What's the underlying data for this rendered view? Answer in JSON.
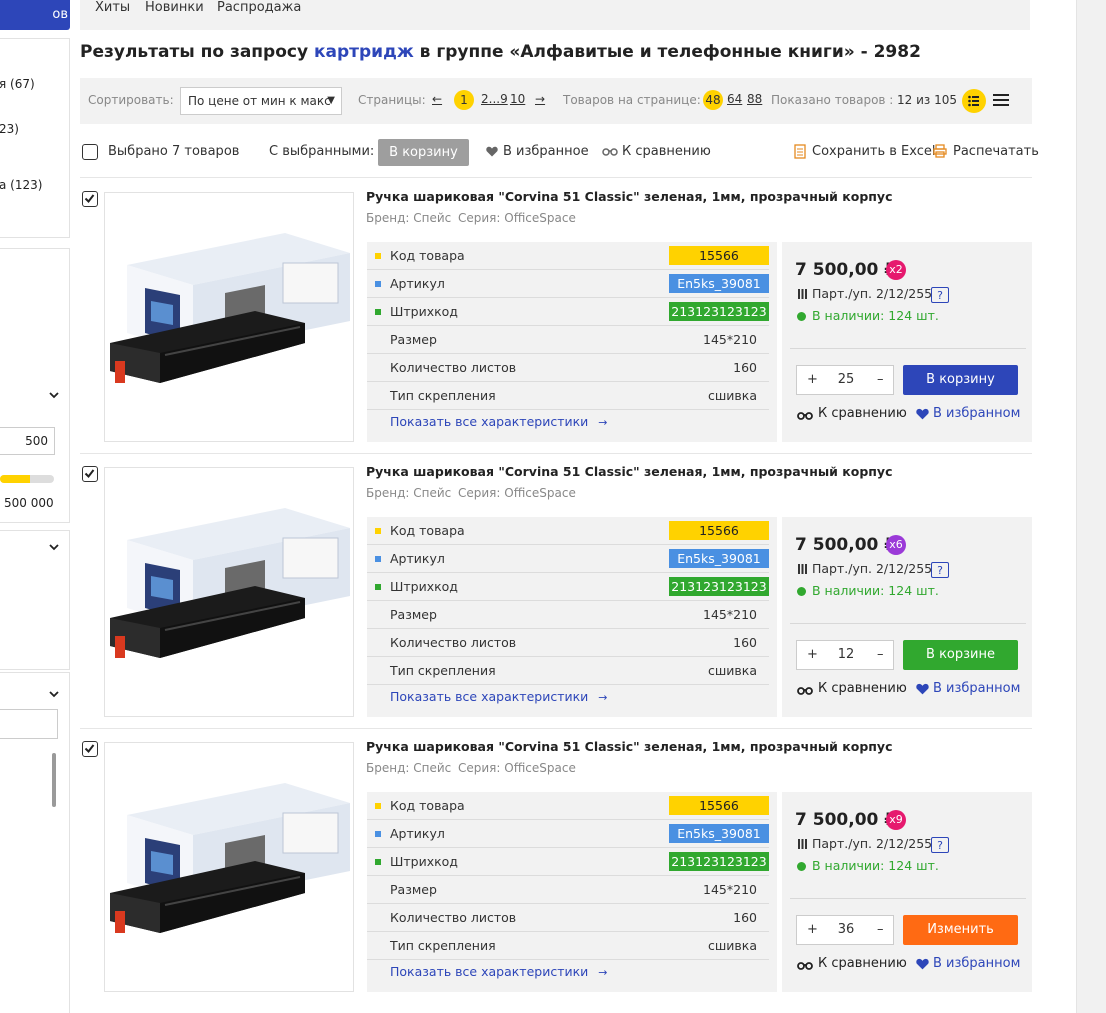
{
  "sidebar": {
    "top_button": "ов",
    "filter_items": [
      "я (67)",
      "23)",
      "а (123)"
    ],
    "price_to": "500 000",
    "slider_max_label": "500 000",
    "slider_level": 0.55
  },
  "nav": {
    "items": [
      "Хиты",
      "Новинки",
      "Распродажа"
    ]
  },
  "search": {
    "prefix": "Результаты по запросу ",
    "query": "картридж",
    "suffix": " в группе «Алфавитые и телефонные книги» - 2982"
  },
  "toolbar": {
    "sort_label": "Сортировать:",
    "sort_value": "По цене от мин к макс",
    "pages_label": "Страницы:",
    "prev": "←",
    "current_page": "1",
    "pages_link_a": "2...9",
    "pages_link_b": "10",
    "next": "→",
    "per_page_label": "Товаров на странице:",
    "per_page_options": [
      "48",
      "64",
      "88"
    ],
    "shown_label": "Показано товаров :",
    "shown_value": "12 из 105"
  },
  "actions": {
    "selected_label": "Выбрано 7 товаров",
    "with_selected": "С выбранными:",
    "to_cart": "В корзину",
    "to_favorites": "В избранное",
    "to_compare": "К сравнению",
    "excel": "Сохранить в Excel",
    "print": "Распечатать"
  },
  "colors": {
    "accent_blue": "#2d46b9",
    "yellow": "#ffd200",
    "light_blue": "#4a90e2",
    "green": "#31a82f",
    "orange": "#ff6a13"
  },
  "products": [
    {
      "title": "Ручка шариковая \"Corvina 51 Classic\" зеленая, 1мм, прозрачный корпус",
      "brand": "Бренд: Спейс",
      "series": "Серия: OfficeSpace",
      "specs": [
        {
          "label": "Код товара",
          "value": "15566"
        },
        {
          "label": "Артикул",
          "value": "En5ks_39081"
        },
        {
          "label": "Штрихкод",
          "value": "213123123123"
        },
        {
          "label": "Размер",
          "value": "145*210"
        },
        {
          "label": "Количество листов",
          "value": "160"
        },
        {
          "label": "Тип скрепления",
          "value": "сшивка"
        }
      ],
      "show_all": "Показать все характеристики",
      "price": "7 500,00 ₽",
      "multiplier": "x2",
      "multiplier_color": "#e6196e",
      "pack": "Парт./уп. 2/12/255",
      "help": "?",
      "stock": "В наличии: 124 шт.",
      "qty": "25",
      "cart_label": "В корзину",
      "cart_color": "#2d46b9",
      "compare": "К сравнению",
      "favorite": "В избранном"
    },
    {
      "title": "Ручка шариковая \"Corvina 51 Classic\" зеленая, 1мм, прозрачный корпус",
      "brand": "Бренд: Спейс",
      "series": "Серия: OfficeSpace",
      "specs": [
        {
          "label": "Код товара",
          "value": "15566"
        },
        {
          "label": "Артикул",
          "value": "En5ks_39081"
        },
        {
          "label": "Штрихкод",
          "value": "213123123123"
        },
        {
          "label": "Размер",
          "value": "145*210"
        },
        {
          "label": "Количество листов",
          "value": "160"
        },
        {
          "label": "Тип скрепления",
          "value": "сшивка"
        }
      ],
      "show_all": "Показать все характеристики",
      "price": "7 500,00 ₽",
      "multiplier": "x6",
      "multiplier_color": "#9b3ad8",
      "pack": "Парт./уп. 2/12/255",
      "help": "?",
      "stock": "В наличии: 124 шт.",
      "qty": "12",
      "cart_label": "В корзине",
      "cart_color": "#31a82f",
      "compare": "К сравнению",
      "favorite": "В избранном"
    },
    {
      "title": "Ручка шариковая \"Corvina 51 Classic\" зеленая, 1мм, прозрачный корпус",
      "brand": "Бренд: Спейс",
      "series": "Серия: OfficeSpace",
      "specs": [
        {
          "label": "Код товара",
          "value": "15566"
        },
        {
          "label": "Артикул",
          "value": "En5ks_39081"
        },
        {
          "label": "Штрихкод",
          "value": "213123123123"
        },
        {
          "label": "Размер",
          "value": "145*210"
        },
        {
          "label": "Количество листов",
          "value": "160"
        },
        {
          "label": "Тип скрепления",
          "value": "сшивка"
        }
      ],
      "show_all": "Показать все характеристики",
      "price": "7 500,00 ₽",
      "multiplier": "x9",
      "multiplier_color": "#e6196e",
      "pack": "Парт./уп. 2/12/255",
      "help": "?",
      "stock": "В наличии: 124 шт.",
      "qty": "36",
      "cart_label": "Изменить",
      "cart_color": "#ff6a13",
      "compare": "К сравнению",
      "favorite": "В избранном"
    }
  ]
}
